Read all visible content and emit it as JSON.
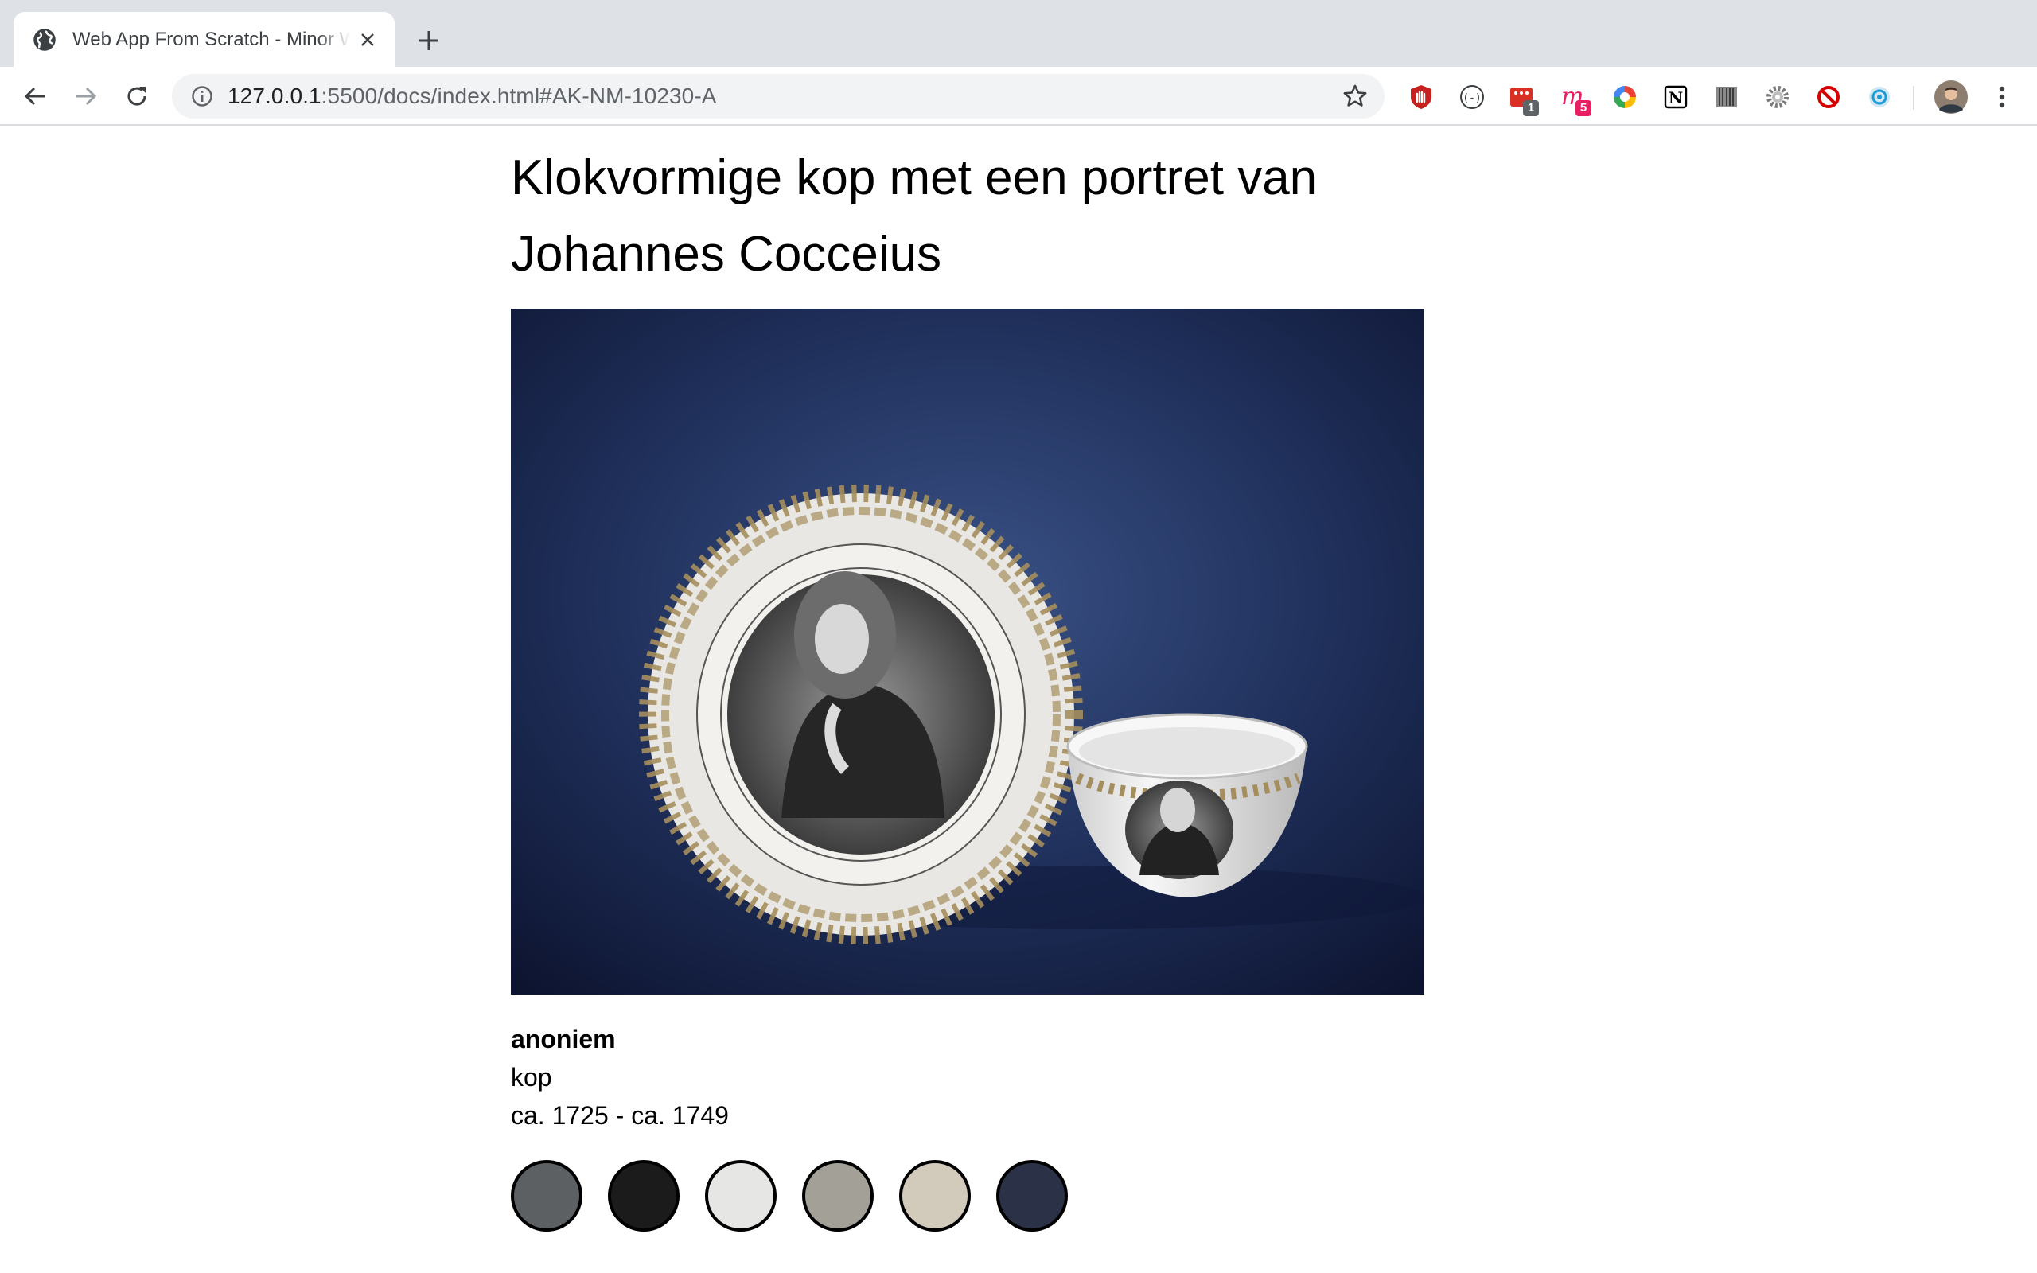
{
  "browser": {
    "tab": {
      "title": "Web App From Scratch - Minor Web Development",
      "favicon": "globe-icon"
    },
    "address": {
      "host": "127.0.0.1",
      "path": ":5500/docs/index.html#AK-NM-10230-A"
    },
    "extensions": [
      {
        "name": "ublock-icon"
      },
      {
        "name": "bracket-extension-icon"
      },
      {
        "name": "todoist-icon",
        "badge": "1"
      },
      {
        "name": "m-extension-icon",
        "badge": "5"
      },
      {
        "name": "color-picker-icon"
      },
      {
        "name": "notion-icon"
      },
      {
        "name": "barcode-icon"
      },
      {
        "name": "gear-extension-icon"
      },
      {
        "name": "block-icon"
      },
      {
        "name": "eye-dropper-icon"
      }
    ]
  },
  "page": {
    "title": "Klokvormige kop met een portret van Johannes Cocceius",
    "image_alt": "Klokvormige kop met een portret van Johannes Cocceius",
    "maker": "anoniem",
    "object_type": "kop",
    "dating": "ca. 1725 - ca. 1749",
    "palette": [
      "#5d6063",
      "#1b1b1b",
      "#e6e6e4",
      "#a3a097",
      "#d2cbbb",
      "#2b3247"
    ]
  }
}
